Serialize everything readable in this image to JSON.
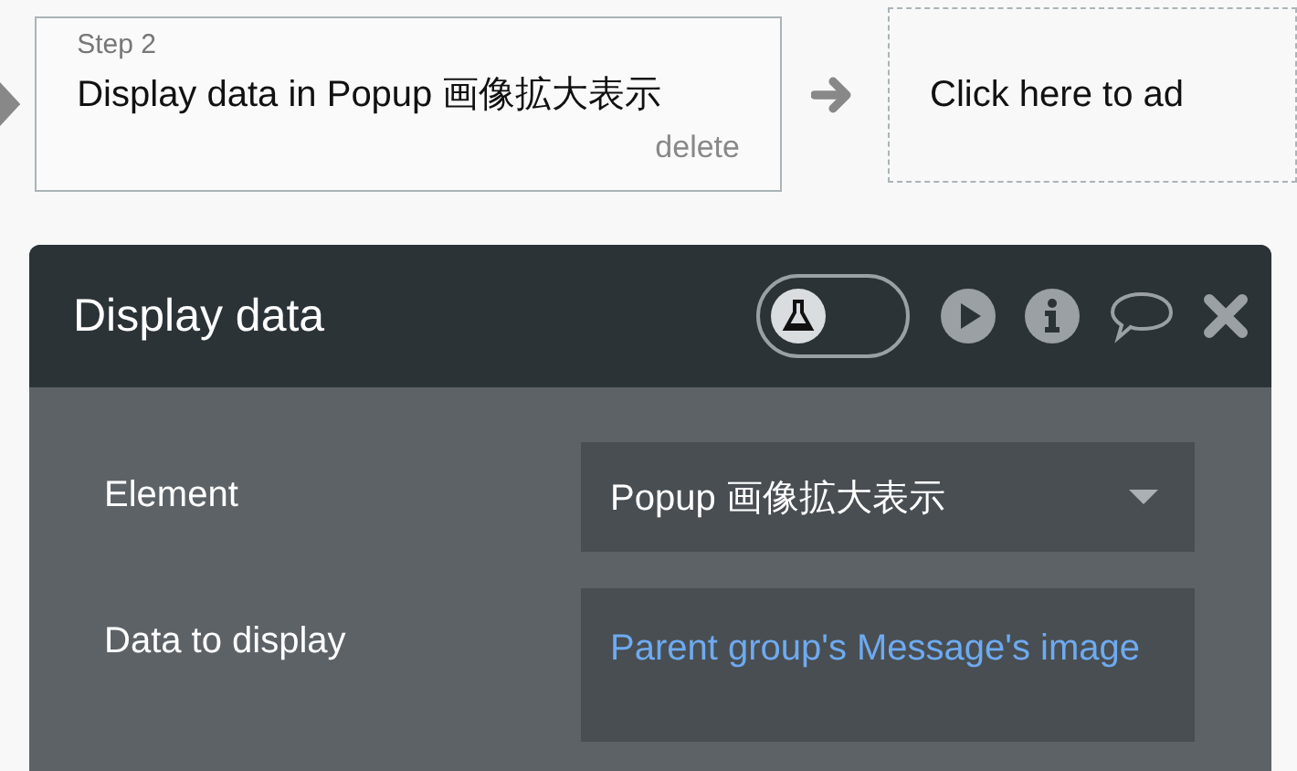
{
  "workflow": {
    "steps": [
      {
        "kind": "step",
        "label": "Step 2",
        "title": "Display data in Popup 画像拡大表示",
        "action": "delete"
      },
      {
        "kind": "add",
        "title": "Click here to ad"
      }
    ]
  },
  "panel": {
    "title": "Display data",
    "test_toggle": {
      "on": false
    },
    "fields": [
      {
        "kind": "dropdown",
        "label": "Element",
        "value": "Popup 画像拡大表示"
      },
      {
        "kind": "expression",
        "label": "Data to display",
        "value": "Parent group's Message's image"
      }
    ]
  }
}
